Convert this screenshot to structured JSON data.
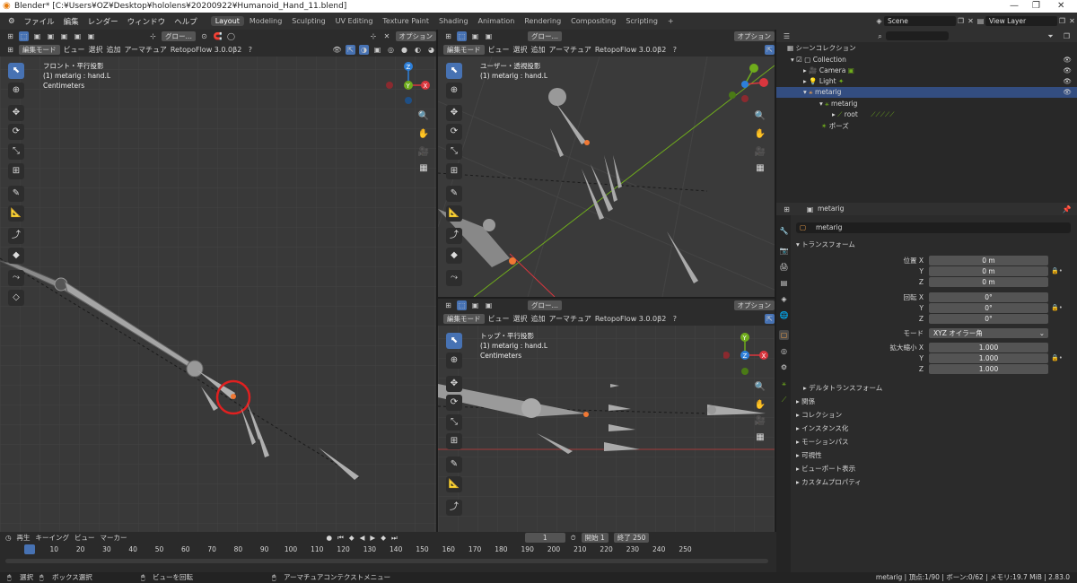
{
  "window": {
    "title": "Blender* [C:¥Users¥OZ¥Desktop¥hololens¥20200922¥Humanoid_Hand_11.blend]",
    "min": "—",
    "max": "❐",
    "close": "✕"
  },
  "menus": [
    "ファイル",
    "編集",
    "レンダー",
    "ウィンドウ",
    "ヘルプ"
  ],
  "workspaces": [
    "Layout",
    "Modeling",
    "Sculpting",
    "UV Editing",
    "Texture Paint",
    "Shading",
    "Animation",
    "Rendering",
    "Compositing",
    "Scripting"
  ],
  "scene": {
    "label": "Scene",
    "view_layer": "View Layer"
  },
  "viewport_header": {
    "mode": "編集モード",
    "menus": [
      "ビュー",
      "選択",
      "追加",
      "アーマチュア"
    ],
    "addon": "RetopoFlow 3.0.0β2",
    "transform": "グロー…",
    "options": "オプション"
  },
  "viewports": {
    "front": {
      "view": "フロント・平行投影",
      "object": "(1) metarig : hand.L",
      "units": "Centimeters"
    },
    "user": {
      "view": "ユーザー・透視投影",
      "object": "(1) metarig : hand.L"
    },
    "top": {
      "view": "トップ・平行投影",
      "object": "(1) metarig : hand.L",
      "units": "Centimeters"
    }
  },
  "gizmo": {
    "z": "Z",
    "y": "Y",
    "x": "X"
  },
  "outliner": {
    "search_placeholder": "",
    "scene_collection": "シーンコレクション",
    "collection": "Collection",
    "camera": "Camera",
    "light": "Light",
    "metarig": "metarig",
    "metarig_data": "metarig",
    "root": "root",
    "pose": "ポーズ"
  },
  "properties": {
    "header": "metarig",
    "name": "metarig",
    "transform_label": "トランスフォーム",
    "location": {
      "label": "位置 X",
      "x": "0 m",
      "y": "0 m",
      "z": "0 m"
    },
    "rotation": {
      "label": "回転 X",
      "x": "0°",
      "y": "0°",
      "z": "0°"
    },
    "mode": {
      "label": "モード",
      "value": "XYZ オイラー角"
    },
    "scale": {
      "label": "拡大縮小 X",
      "x": "1.000",
      "y": "1.000",
      "z": "1.000"
    },
    "axis_y": "Y",
    "axis_z": "Z",
    "delta": "デルタトランスフォーム",
    "panels": [
      "関係",
      "コレクション",
      "インスタンス化",
      "モーションパス",
      "可視性",
      "ビューポート表示",
      "カスタムプロパティ"
    ]
  },
  "timeline": {
    "menus": [
      "再生",
      "キーイング",
      "ビュー",
      "マーカー"
    ],
    "current": "1",
    "start_label": "開始",
    "start": "1",
    "end_label": "終了",
    "end": "250",
    "ticks": [
      "1",
      "10",
      "20",
      "30",
      "40",
      "50",
      "60",
      "70",
      "80",
      "90",
      "100",
      "110",
      "120",
      "130",
      "140",
      "150",
      "160",
      "170",
      "180",
      "190",
      "200",
      "210",
      "220",
      "230",
      "240",
      "250"
    ]
  },
  "status": {
    "select": "選択",
    "box_select": "ボックス選択",
    "rotate_view": "ビューを回転",
    "context_menu": "アーマチュアコンテクストメニュー",
    "stats": "metarig | 頂点:1/90 | ボーン:0/62 | メモリ:19.7 MiB | 2.83.0"
  },
  "colors": {
    "accent": "#4772b3",
    "x_axis": "#d9363e",
    "y_axis": "#6fac1c",
    "z_axis": "#2d7fd9",
    "selected": "#f07834"
  }
}
